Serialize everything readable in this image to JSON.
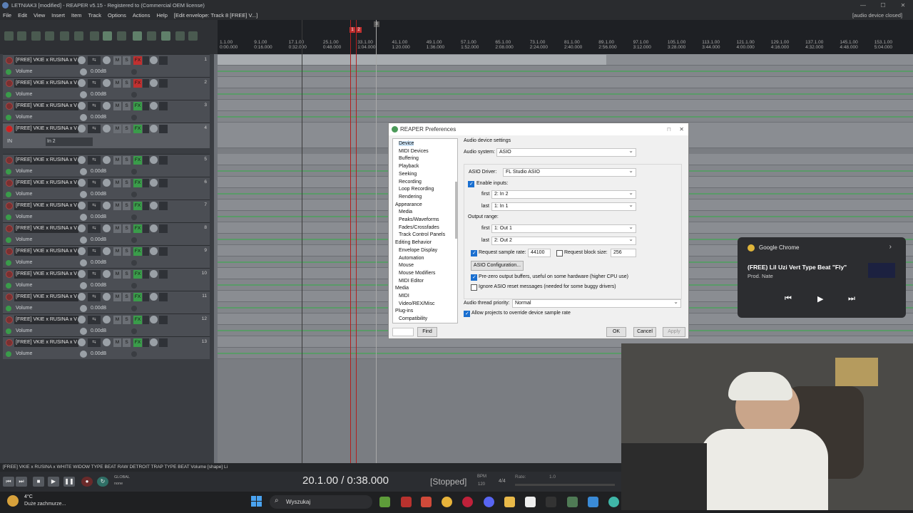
{
  "window": {
    "title": "LETNIAK3 [modified] - REAPER v5.15 - Registered to  (Commercial OEM license)"
  },
  "menu": {
    "items": [
      "File",
      "Edit",
      "View",
      "Insert",
      "Item",
      "Track",
      "Options",
      "Actions",
      "Help",
      "[Edit envelope: Track 8 [FREE] V...]"
    ],
    "right_status": "[audio device closed]"
  },
  "ruler": {
    "marker1": "1",
    "marker2": "2",
    "marker3": "3",
    "ticks": [
      {
        "bar": "1.1.00",
        "time": "0:00.000"
      },
      {
        "bar": "9.1.00",
        "time": "0:16.000"
      },
      {
        "bar": "17.1.00",
        "time": "0:32.000"
      },
      {
        "bar": "25.1.00",
        "time": "0:48.000"
      },
      {
        "bar": "33.1.00",
        "time": "1:04.000"
      },
      {
        "bar": "41.1.00",
        "time": "1:20.000"
      },
      {
        "bar": "49.1.00",
        "time": "1:36.000"
      },
      {
        "bar": "57.1.00",
        "time": "1:52.000"
      },
      {
        "bar": "65.1.00",
        "time": "2:08.000"
      },
      {
        "bar": "73.1.00",
        "time": "2:24.000"
      },
      {
        "bar": "81.1.00",
        "time": "2:40.000"
      },
      {
        "bar": "89.1.00",
        "time": "2:56.000"
      },
      {
        "bar": "97.1.00",
        "time": "3:12.000"
      },
      {
        "bar": "105.1.00",
        "time": "3:28.000"
      },
      {
        "bar": "113.1.00",
        "time": "3:44.000"
      },
      {
        "bar": "121.1.00",
        "time": "4:00.000"
      },
      {
        "bar": "129.1.00",
        "time": "4:16.000"
      },
      {
        "bar": "137.1.00",
        "time": "4:32.000"
      },
      {
        "bar": "145.1.00",
        "time": "4:48.000"
      },
      {
        "bar": "153.1.00",
        "time": "5:04.000"
      }
    ]
  },
  "tracks": {
    "name": "[FREE] VKIE x RUSINA x V",
    "env_label": "Volume",
    "env_value": "0.00dB",
    "btn_m": "M",
    "btn_s": "S",
    "btn_fx": "FX",
    "in_label": "IN",
    "in_value": "In 2",
    "numbers": [
      "1",
      "2",
      "3",
      "4",
      "5",
      "6",
      "7",
      "8",
      "9",
      "10",
      "11",
      "12",
      "13"
    ]
  },
  "status_line": "[FREE] VKIE x RUSINA x WHITE WIDOW TYPE BEAT  RAW  DETROIT TRAP TYPE BEAT Volume [shape] Li",
  "transport": {
    "position": "20.1.00 / 0:38.000",
    "state": "[Stopped]",
    "bpm_label": "BPM",
    "bpm": "120",
    "sig": "4/4",
    "rate_label": "Rate:",
    "rate": "1.0",
    "global_label": "GLOBAL",
    "global_value": "none"
  },
  "dialog": {
    "title": "REAPER Preferences",
    "tree": [
      {
        "label": "Device",
        "indent": 1,
        "selected": true
      },
      {
        "label": "MIDI Devices",
        "indent": 1
      },
      {
        "label": "Buffering",
        "indent": 1
      },
      {
        "label": "Playback",
        "indent": 1
      },
      {
        "label": "Seeking",
        "indent": 1
      },
      {
        "label": "Recording",
        "indent": 1
      },
      {
        "label": "Loop Recording",
        "indent": 1
      },
      {
        "label": "Rendering",
        "indent": 1
      },
      {
        "label": "Appearance",
        "indent": 0
      },
      {
        "label": "Media",
        "indent": 1
      },
      {
        "label": "Peaks/Waveforms",
        "indent": 1
      },
      {
        "label": "Fades/Crossfades",
        "indent": 1
      },
      {
        "label": "Track Control Panels",
        "indent": 1
      },
      {
        "label": "Editing Behavior",
        "indent": 0
      },
      {
        "label": "Envelope Display",
        "indent": 1
      },
      {
        "label": "Automation",
        "indent": 1
      },
      {
        "label": "Mouse",
        "indent": 1
      },
      {
        "label": "Mouse Modifiers",
        "indent": 1
      },
      {
        "label": "MIDI Editor",
        "indent": 1
      },
      {
        "label": "Media",
        "indent": 0
      },
      {
        "label": "MIDI",
        "indent": 1
      },
      {
        "label": "Video/REX/Misc",
        "indent": 1
      },
      {
        "label": "Plug-ins",
        "indent": 0
      },
      {
        "label": "Compatibility",
        "indent": 1
      }
    ],
    "section_title": "Audio device settings",
    "audio_system_label": "Audio system:",
    "audio_system": "ASIO",
    "asio_driver_label": "ASIO Driver:",
    "asio_driver": "FL Studio ASIO",
    "enable_inputs": "Enable inputs:",
    "first_label": "first",
    "last_label": "last",
    "input_first": "2: In 2",
    "input_last": "1: In 1",
    "output_range": "Output range:",
    "output_first": "1: Out 1",
    "output_last": "2: Out 2",
    "req_sample_rate": "Request sample rate:",
    "sample_rate": "44100",
    "req_block_size": "Request block size:",
    "block_size": "256",
    "asio_config": "ASIO Configuration...",
    "prezero": "Pre-zero output buffers, useful on some hardware (higher CPU use)",
    "ignore_reset": "Ignore ASIO reset messages (needed for some buggy drivers)",
    "thread_priority_label": "Audio thread priority:",
    "thread_priority": "Normal",
    "allow_override": "Allow projects to override device sample rate",
    "find": "Find",
    "ok": "OK",
    "cancel": "Cancel",
    "apply": "Apply"
  },
  "media_popup": {
    "app": "Google Chrome",
    "title": "(FREE) Lil Uzi Vert Type Beat \"Fly\"",
    "artist": "Prod. Nate"
  },
  "taskbar": {
    "weather_temp": "4°C",
    "weather_desc": "Duże zachmurze...",
    "search": "Wyszukaj"
  },
  "colors": {
    "envelope": "#5a9a68",
    "record": "#c03030",
    "accent": "#1a6fd0"
  }
}
